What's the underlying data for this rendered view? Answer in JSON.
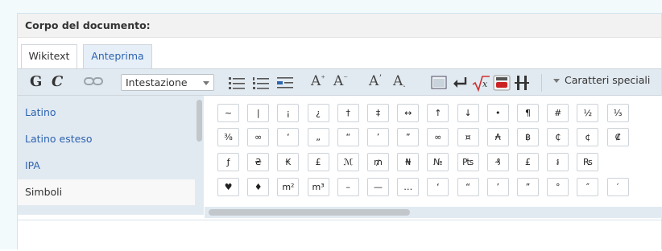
{
  "doc_header": {
    "label": "Corpo del documento:"
  },
  "tabs": [
    {
      "label": "Wikitext"
    },
    {
      "label": "Anteprima"
    }
  ],
  "toolbar": {
    "bold": "G",
    "italic": "C",
    "heading_select": "Intestazione",
    "big": "A",
    "small": "A",
    "sup": "A",
    "sub": "A",
    "special_chars": "Caratteri speciali"
  },
  "sidebar": {
    "items": [
      {
        "label": "Latino"
      },
      {
        "label": "Latino esteso"
      },
      {
        "label": "IPA"
      },
      {
        "label": "Simboli"
      }
    ]
  },
  "chars": {
    "row1": [
      "~",
      "|",
      "¡",
      "¿",
      "†",
      "‡",
      "↔",
      "↑",
      "↓",
      "•",
      "¶",
      "#",
      "½",
      "⅓"
    ],
    "row2": [
      "⅜",
      "∞",
      "‘",
      "„",
      "“",
      "’",
      "”",
      "∞",
      "¤",
      "₳",
      "฿",
      "₵",
      "¢",
      "₡"
    ],
    "row3": [
      "ƒ",
      "₴",
      "₭",
      "£",
      "ℳ",
      "₥",
      "₦",
      "№",
      "₧",
      "₰",
      "£",
      "៛",
      "₨"
    ],
    "row4": [
      "♥",
      "♦",
      "m²",
      "m³",
      "–",
      "—",
      "…",
      "‘",
      "“",
      "’",
      "”",
      "°",
      "″",
      "′"
    ]
  },
  "colors": {
    "accent": "#2d63b0",
    "toolbar_bg": "#e2eaf1"
  }
}
